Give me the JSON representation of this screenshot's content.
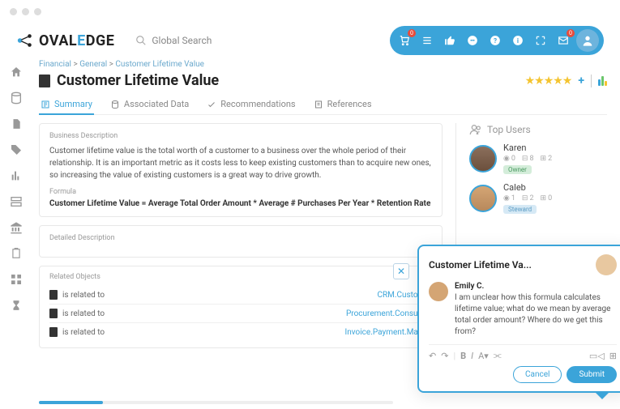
{
  "logo": {
    "text_pre": "OVAL",
    "text_post": "DGE",
    "accent_char": "E"
  },
  "search": {
    "placeholder": "Global Search"
  },
  "breadcrumb": [
    "Financial",
    "General",
    "Customer Lifetime Value"
  ],
  "page_title": "Customer Lifetime Value",
  "tabs": [
    {
      "label": "Summary",
      "active": true
    },
    {
      "label": "Associated Data"
    },
    {
      "label": "Recommendations"
    },
    {
      "label": "References"
    }
  ],
  "business_desc": {
    "label": "Business Description",
    "text": "Customer lifetime value is the total worth of a customer to a business over the whole period of their relationship. It is an important metric as it costs less to keep existing customers than to acquire new ones, so increasing the value of existing customers is a great way to drive growth.",
    "formula_label": "Formula",
    "formula": "Customer Lifetime Value = Average Total Order Amount * Average # Purchases Per Year * Retention Rate"
  },
  "detailed_desc": {
    "label": "Detailed Description"
  },
  "related": {
    "label": "Related Objects",
    "rows": [
      {
        "rel": "is related to",
        "target": "CRM.Customer"
      },
      {
        "rel": "is related to",
        "target": "Procurement.Consumer"
      },
      {
        "rel": "is related to",
        "target": "Invoice.Payment.Master"
      }
    ]
  },
  "top_users": {
    "heading": "Top Users",
    "users": [
      {
        "name": "Karen",
        "s1": "0",
        "s2": "8",
        "s3": "2",
        "role": "Owner",
        "role_class": "owner"
      },
      {
        "name": "Caleb",
        "s1": "1",
        "s2": "2",
        "s3": "0",
        "role": "Steward",
        "role_class": "steward"
      }
    ]
  },
  "comment_popup": {
    "title": "Customer Lifetime Va...",
    "author": "Emily C.",
    "message": "I am unclear how this formula calculates lifetime value; what do we mean by average total order amount? Where do we get this from?",
    "cancel": "Cancel",
    "submit": "Submit"
  },
  "topbar_badges": {
    "cart": "0",
    "mail": "0"
  },
  "colors": {
    "accent": "#3ba4d9",
    "star": "#f4c430"
  }
}
